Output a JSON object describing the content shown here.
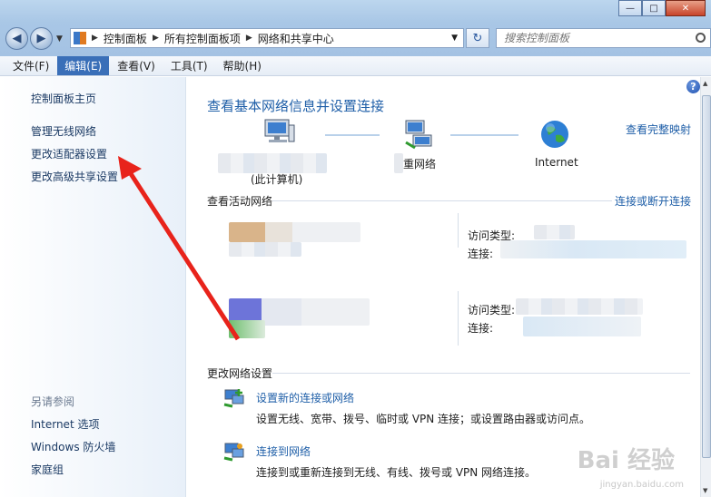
{
  "nav": {
    "back": "◀",
    "forward": "▶",
    "breadcrumb": [
      "控制面板",
      "所有控制面板项",
      "网络和共享中心"
    ],
    "search_placeholder": "搜索控制面板"
  },
  "menu": [
    "文件(F)",
    "编辑(E)",
    "查看(V)",
    "工具(T)",
    "帮助(H)"
  ],
  "sidebar": {
    "home": "控制面板主页",
    "links": [
      "管理无线网络",
      "更改适配器设置",
      "更改高级共享设置"
    ],
    "see_also_heading": "另请参阅",
    "see_also": [
      "Internet 选项",
      "Windows 防火墙",
      "家庭组"
    ]
  },
  "main": {
    "title": "查看基本网络信息并设置连接",
    "full_map_link": "查看完整映射",
    "map": {
      "this_pc": "(此计算机)",
      "network": "重网络",
      "internet": "Internet"
    },
    "active_networks_label": "查看活动网络",
    "connect_disconnect_link": "连接或断开连接",
    "access_type_label": "访问类型:",
    "connection_label": "连接:",
    "change_settings_label": "更改网络设置",
    "tasks": [
      {
        "title": "设置新的连接或网络",
        "desc": "设置无线、宽带、拨号、临时或 VPN 连接；或设置路由器或访问点。"
      },
      {
        "title": "连接到网络",
        "desc": "连接到或重新连接到无线、有线、拨号或 VPN 网络连接。"
      }
    ]
  },
  "watermark": {
    "logo": "Bai 经验",
    "url": "jingyan.baidu.com"
  },
  "colors": {
    "link": "#1f5fa8",
    "arrow": "#e8231b",
    "menu_active": "#3a6fb8"
  }
}
